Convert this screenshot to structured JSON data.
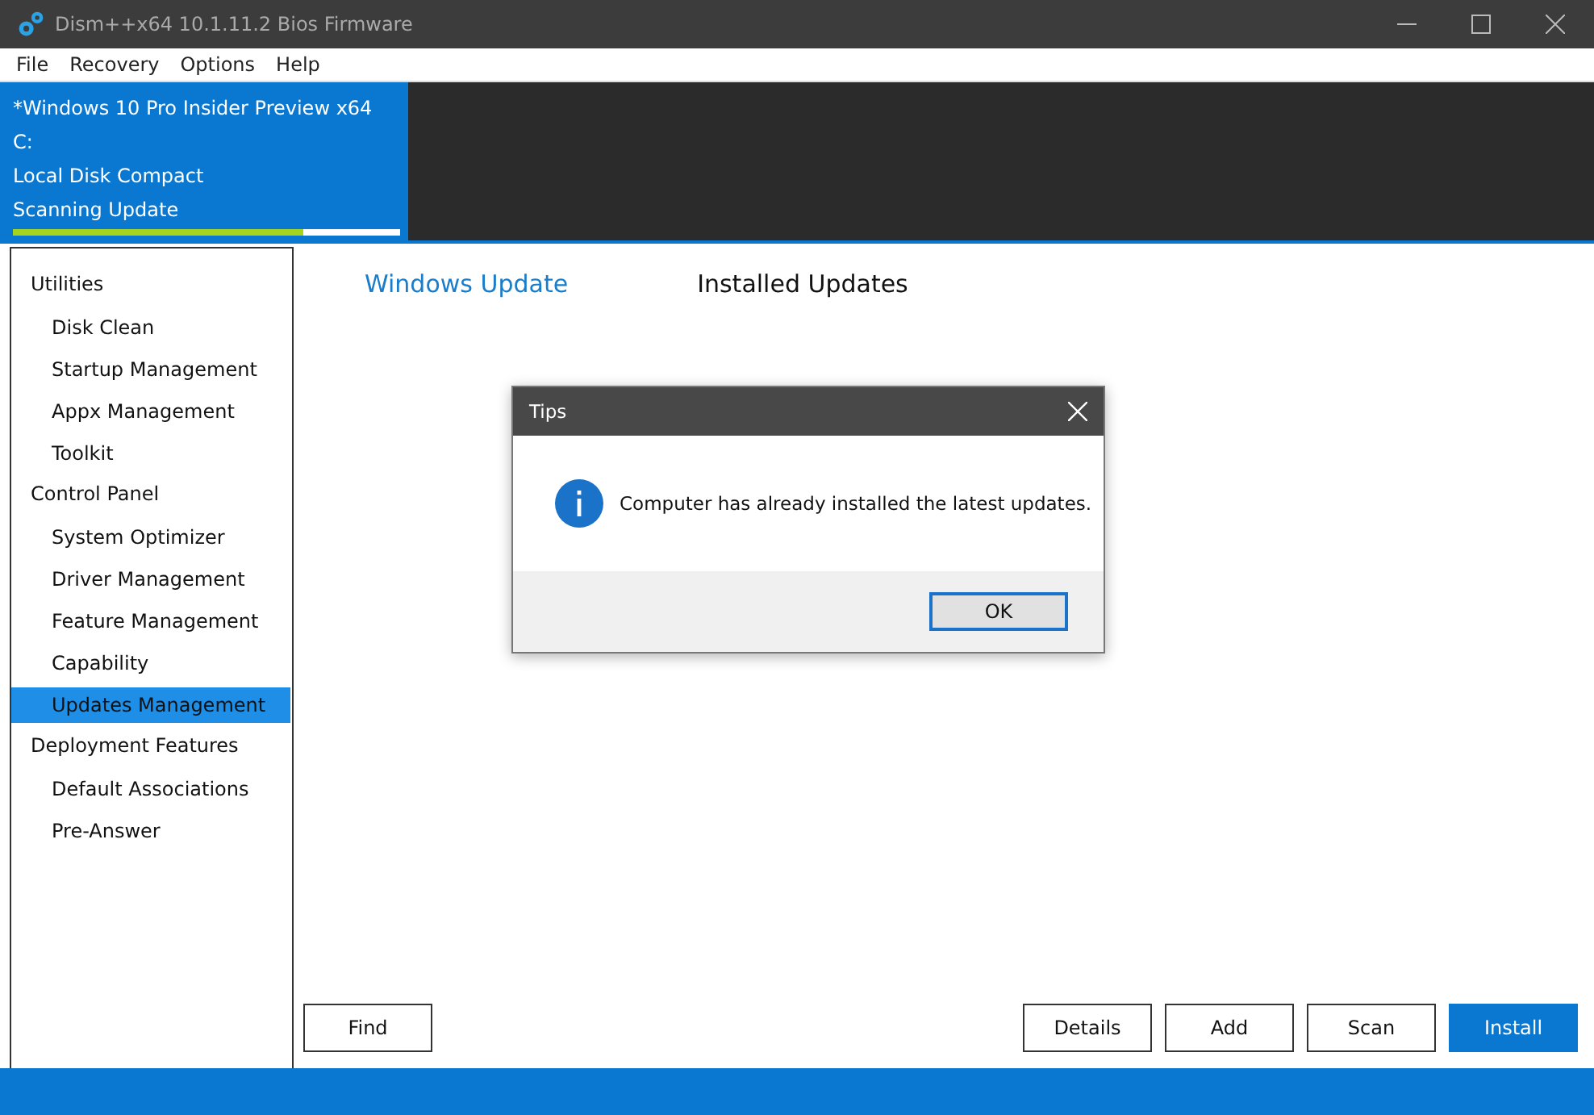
{
  "window": {
    "title": "Dism++x64 10.1.11.2 Bios Firmware"
  },
  "menu": [
    "File",
    "Recovery",
    "Options",
    "Help"
  ],
  "session": {
    "lines": [
      "*Windows 10 Pro Insider Preview x64",
      "C:",
      "Local Disk Compact",
      "Scanning Update"
    ],
    "progress": {
      "level": 0.75
    }
  },
  "sidebar": [
    {
      "label": "Utilities",
      "children": [
        {
          "label": "Disk Clean",
          "selected": false
        },
        {
          "label": "Startup Management",
          "selected": false
        },
        {
          "label": "Appx Management",
          "selected": false
        },
        {
          "label": "Toolkit",
          "selected": false
        }
      ]
    },
    {
      "label": "Control Panel",
      "children": [
        {
          "label": "System Optimizer",
          "selected": false
        },
        {
          "label": "Driver Management",
          "selected": false
        },
        {
          "label": "Feature Management",
          "selected": false
        },
        {
          "label": "Capability",
          "selected": false
        },
        {
          "label": "Updates Management",
          "selected": true
        }
      ]
    },
    {
      "label": "Deployment Features",
      "children": [
        {
          "label": "Default Associations",
          "selected": false
        },
        {
          "label": "Pre-Answer",
          "selected": false
        }
      ]
    }
  ],
  "tabs": [
    {
      "label": "Windows Update",
      "selected": true
    },
    {
      "label": "Installed Updates",
      "selected": false
    }
  ],
  "buttons_left": [
    "Find"
  ],
  "buttons_right": [
    {
      "label": "Details",
      "primary": false
    },
    {
      "label": "Add",
      "primary": false
    },
    {
      "label": "Scan",
      "primary": false
    },
    {
      "label": "Install",
      "primary": true
    }
  ],
  "dialog": {
    "title": "Tips",
    "message": "Computer has already installed the latest updates.",
    "button": "OK"
  }
}
